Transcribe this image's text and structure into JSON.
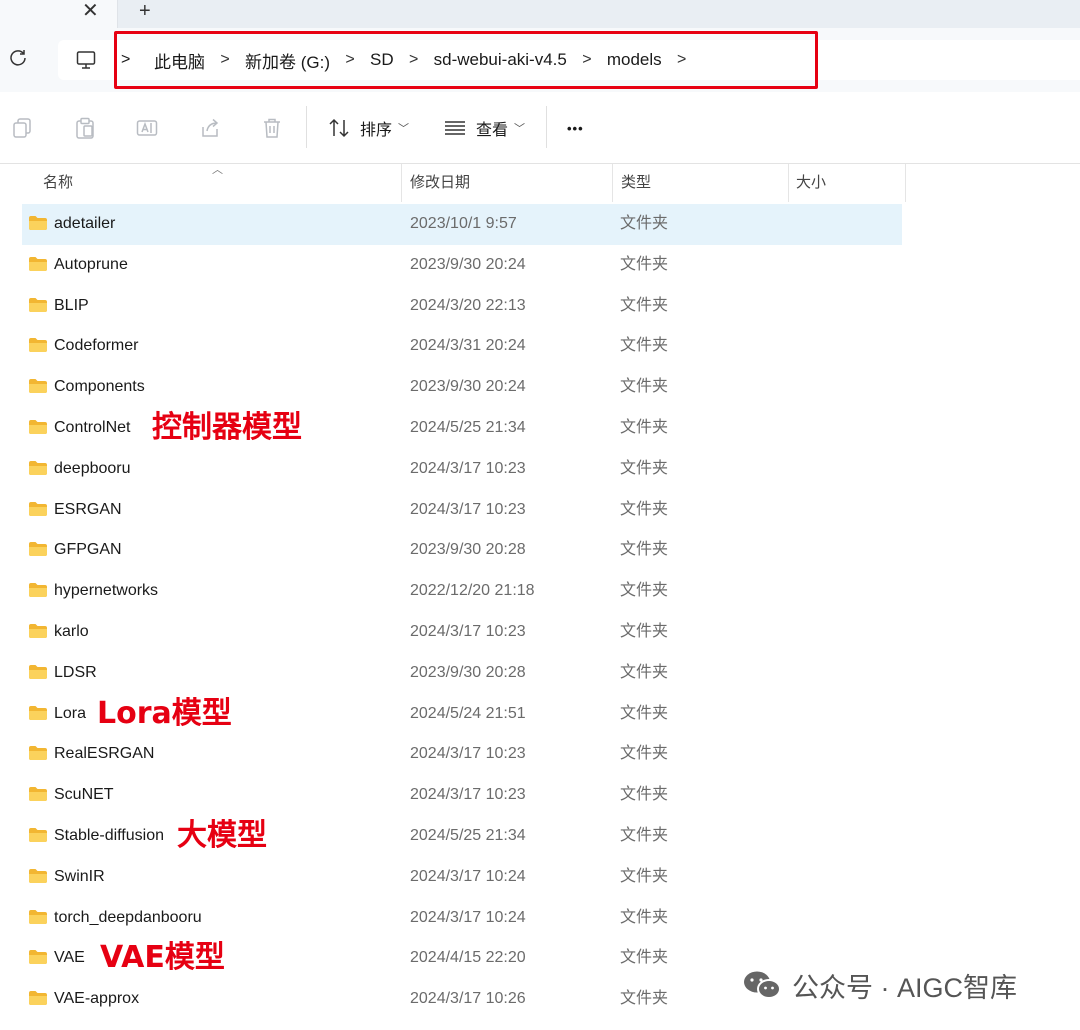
{
  "tabs": {
    "close_glyph": "✕",
    "new_glyph": "+"
  },
  "breadcrumb": [
    "此电脑",
    "新加卷 (G:)",
    "SD",
    "sd-webui-aki-v4.5",
    "models"
  ],
  "toolbar": {
    "sort_label": "排序",
    "view_label": "查看",
    "more_label": "•••"
  },
  "columns": {
    "name": "名称",
    "date": "修改日期",
    "type": "类型",
    "size": "大小"
  },
  "rows": [
    {
      "name": "adetailer",
      "date": "2023/10/1 9:57",
      "type": "文件夹"
    },
    {
      "name": "Autoprune",
      "date": "2023/9/30 20:24",
      "type": "文件夹"
    },
    {
      "name": "BLIP",
      "date": "2024/3/20 22:13",
      "type": "文件夹"
    },
    {
      "name": "Codeformer",
      "date": "2024/3/31 20:24",
      "type": "文件夹"
    },
    {
      "name": "Components",
      "date": "2023/9/30 20:24",
      "type": "文件夹"
    },
    {
      "name": "ControlNet",
      "date": "2024/5/25 21:34",
      "type": "文件夹"
    },
    {
      "name": "deepbooru",
      "date": "2024/3/17 10:23",
      "type": "文件夹"
    },
    {
      "name": "ESRGAN",
      "date": "2024/3/17 10:23",
      "type": "文件夹"
    },
    {
      "name": "GFPGAN",
      "date": "2023/9/30 20:28",
      "type": "文件夹"
    },
    {
      "name": "hypernetworks",
      "date": "2022/12/20 21:18",
      "type": "文件夹"
    },
    {
      "name": "karlo",
      "date": "2024/3/17 10:23",
      "type": "文件夹"
    },
    {
      "name": "LDSR",
      "date": "2023/9/30 20:28",
      "type": "文件夹"
    },
    {
      "name": "Lora",
      "date": "2024/5/24 21:51",
      "type": "文件夹"
    },
    {
      "name": "RealESRGAN",
      "date": "2024/3/17 10:23",
      "type": "文件夹"
    },
    {
      "name": "ScuNET",
      "date": "2024/3/17 10:23",
      "type": "文件夹"
    },
    {
      "name": "Stable-diffusion",
      "date": "2024/5/25 21:34",
      "type": "文件夹"
    },
    {
      "name": "SwinIR",
      "date": "2024/3/17 10:24",
      "type": "文件夹"
    },
    {
      "name": "torch_deepdanbooru",
      "date": "2024/3/17 10:24",
      "type": "文件夹"
    },
    {
      "name": "VAE",
      "date": "2024/4/15 22:20",
      "type": "文件夹"
    },
    {
      "name": "VAE-approx",
      "date": "2024/3/17 10:26",
      "type": "文件夹"
    }
  ],
  "annotations": {
    "controlnet": "控制器模型",
    "lora": "Lora模型",
    "stable_diffusion": "大模型",
    "vae": "VAE模型"
  },
  "watermark": {
    "text": "公众号 · AIGC智库"
  },
  "colors": {
    "annotation_red": "#e60012",
    "selection": "#e5f3fb",
    "folder_yellow": "#f5c142"
  }
}
